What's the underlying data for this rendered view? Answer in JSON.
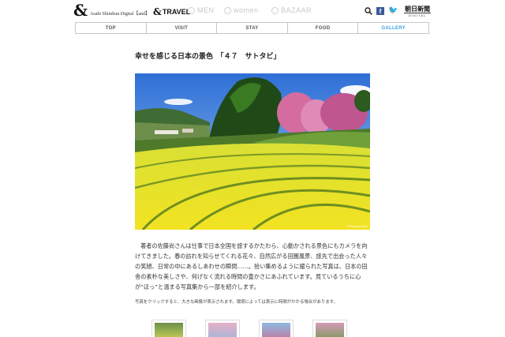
{
  "header": {
    "brand_logo": "&",
    "brand_text": "Asahi Shimbun Digital【and】",
    "sites": [
      {
        "amp": "&",
        "label": "TRAVEL"
      },
      {
        "label": "MEN"
      },
      {
        "label": "women"
      },
      {
        "label": "BAZAAR"
      }
    ],
    "social": {
      "facebook": "f",
      "twitter": "🐦"
    },
    "publisher": {
      "name": "朝日新聞",
      "sub": "DIGITAL"
    }
  },
  "nav": {
    "tabs": [
      {
        "label": "TOP"
      },
      {
        "label": "VISIT"
      },
      {
        "label": "STAY"
      },
      {
        "label": "FOOD"
      },
      {
        "label": "GALLERY"
      }
    ],
    "active": "GALLERY"
  },
  "article": {
    "title": "幸せを感じる日本の景色　「４７　サトタビ」",
    "photo_credit": "© Hisashi Sato",
    "description": "著者の佐藤尚さんは仕事で日本全国を旅するかたわら、心動かされる景色にもカメラを向けてきました。春の訪れを知らせてくれる花々、自然広がる田園風景、旅先で出会った人々の笑顔、日常の中にあるしあわせの瞬間……。拾い集めるように撮られた写真は、日本の田舎の素朴な美しさや、何げなく流れる時間の豊かさにあふれています。見ているうちに心が“ほっ”と温まる写真集から一部を紹介します。",
    "note": "写真をクリックすると、大きな画像が表示されます。環境によっては表示に時間がかかる場合があります。"
  },
  "colors": {
    "accent": "#3ba5e0",
    "facebook": "#3b5998",
    "twitter": "#1da1f2"
  }
}
